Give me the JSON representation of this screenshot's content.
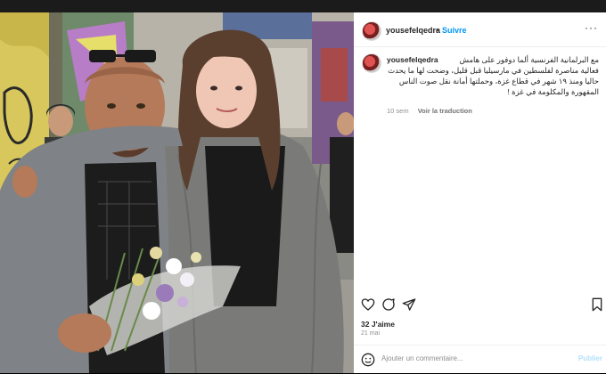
{
  "post": {
    "username": "yousefelqedra",
    "separator": "•",
    "follow_label": "Suivre",
    "more_label": "···",
    "caption_username": "yousefelqedra",
    "caption_text": "مع البرلمانية الفرنسية ألما دوفور على هامش فعالية مناصرة لفلسطين في مارسيليا قبل قليل، وضحت لها ما يحدث حاليا ومنذ ١٩ شهر في قطاع غزة، وحملتها أمانة نقل صوت الناس المقهورة والمكلومة في غزة !",
    "caption_age": "10 sem",
    "translate_label": "Voir la traduction",
    "likes": "32 J'aime",
    "date": "21 mai",
    "comment_placeholder": "Ajouter un commentaire...",
    "publish_label": "Publier"
  },
  "icons": {
    "avatar": "profile-avatar",
    "like": "heart-icon",
    "comment": "comment-icon",
    "share": "share-icon",
    "save": "bookmark-icon",
    "emoji": "emoji-icon"
  },
  "colors": {
    "accent": "#0095f6",
    "text": "#262626",
    "muted": "#8e8e8e"
  }
}
